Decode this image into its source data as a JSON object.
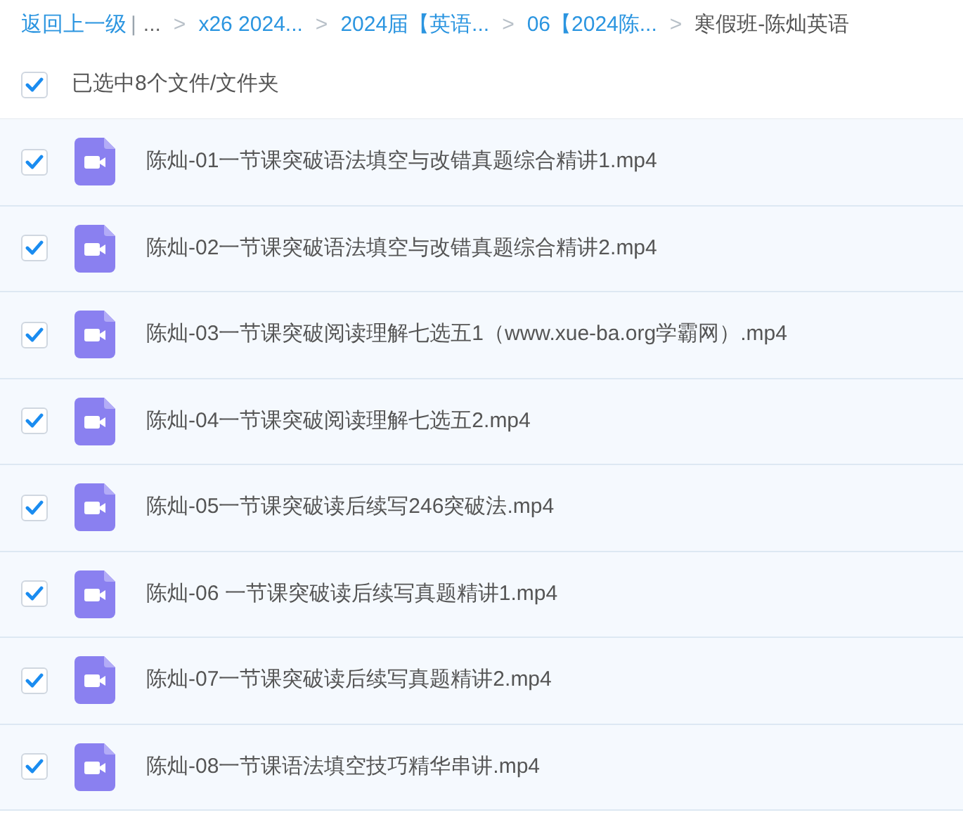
{
  "breadcrumb": {
    "back": "返回上一级",
    "divider": "|",
    "ellipsis": "...",
    "separator": ">",
    "crumbs": [
      {
        "label": "x26 2024...",
        "current": false
      },
      {
        "label": "2024届【英语...",
        "current": false
      },
      {
        "label": "06【2024陈...",
        "current": false
      },
      {
        "label": "寒假班-陈灿英语",
        "current": true
      }
    ]
  },
  "select_all": {
    "checked": true,
    "label": "已选中8个文件/文件夹"
  },
  "files": [
    {
      "name": "陈灿-01一节课突破语法填空与改错真题综合精讲1.mp4",
      "checked": true
    },
    {
      "name": "陈灿-02一节课突破语法填空与改错真题综合精讲2.mp4",
      "checked": true
    },
    {
      "name": "陈灿-03一节课突破阅读理解七选五1（www.xue-ba.org学霸网）.mp4",
      "checked": true
    },
    {
      "name": "陈灿-04一节课突破阅读理解七选五2.mp4",
      "checked": true
    },
    {
      "name": "陈灿-05一节课突破读后续写246突破法.mp4",
      "checked": true
    },
    {
      "name": "陈灿-06 一节课突破读后续写真题精讲1.mp4",
      "checked": true
    },
    {
      "name": "陈灿-07一节课突破读后续写真题精讲2.mp4",
      "checked": true
    },
    {
      "name": "陈灿-08一节课语法填空技巧精华串讲.mp4",
      "checked": true
    }
  ]
}
